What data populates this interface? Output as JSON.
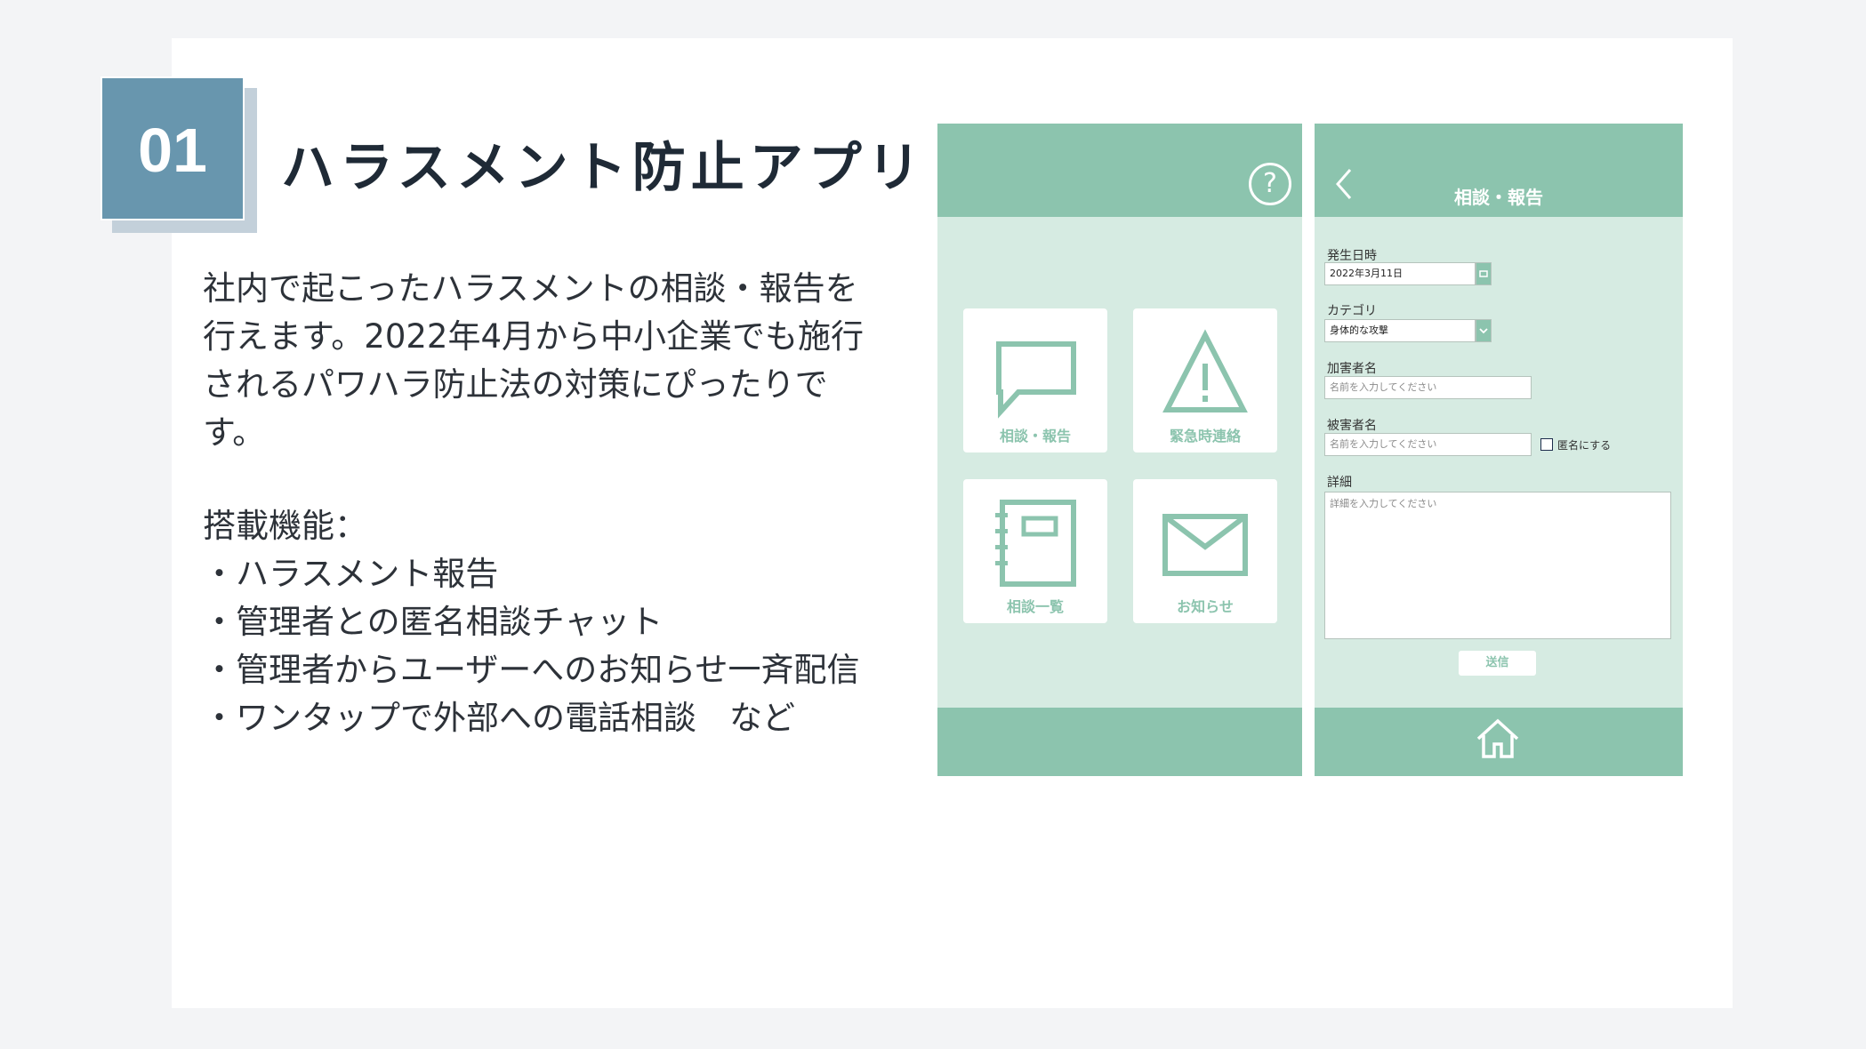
{
  "slide": {
    "number": "01",
    "title": "ハラスメント防止アプリ",
    "description": [
      "社内で起こったハラスメントの相談・報告を",
      "行えます。2022年4月から中小企業でも施行",
      "されるパワハラ防止法の対策にぴったりで",
      "す。"
    ],
    "features_heading": "搭載機能：",
    "features": [
      "ハラスメント報告",
      "管理者との匿名相談チャット",
      "管理者からユーザーへのお知らせ一斉配信",
      "ワンタップで外部への電話相談　など"
    ]
  },
  "home_screen": {
    "help_glyph": "?",
    "tiles": [
      {
        "label": "相談・報告",
        "icon": "speech-bubble-icon"
      },
      {
        "label": "緊急時連絡",
        "icon": "warning-icon"
      },
      {
        "label": "相談一覧",
        "icon": "notebook-icon"
      },
      {
        "label": "お知らせ",
        "icon": "envelope-icon"
      }
    ]
  },
  "form_screen": {
    "header_title": "相談・報告",
    "fields": {
      "date_label": "発生日時",
      "date_value": "2022年3月11日",
      "category_label": "カテゴリ",
      "category_value": "身体的な攻撃",
      "assailant_label": "加害者名",
      "assailant_placeholder": "名前を入力してください",
      "victim_label": "被害者名",
      "victim_placeholder": "名前を入力してください",
      "anonymous_label": "匿名にする",
      "detail_label": "詳細",
      "detail_placeholder": "詳細を入力してください"
    },
    "send_label": "送信",
    "icons": [
      "back-chevron-icon",
      "calendar-icon",
      "chevron-down-icon",
      "home-icon"
    ]
  },
  "colors": {
    "accent": "#8cc4ae",
    "screen_bg": "#d6ebe2",
    "badge": "#6896ae",
    "badge_shadow": "#c3d0da"
  }
}
